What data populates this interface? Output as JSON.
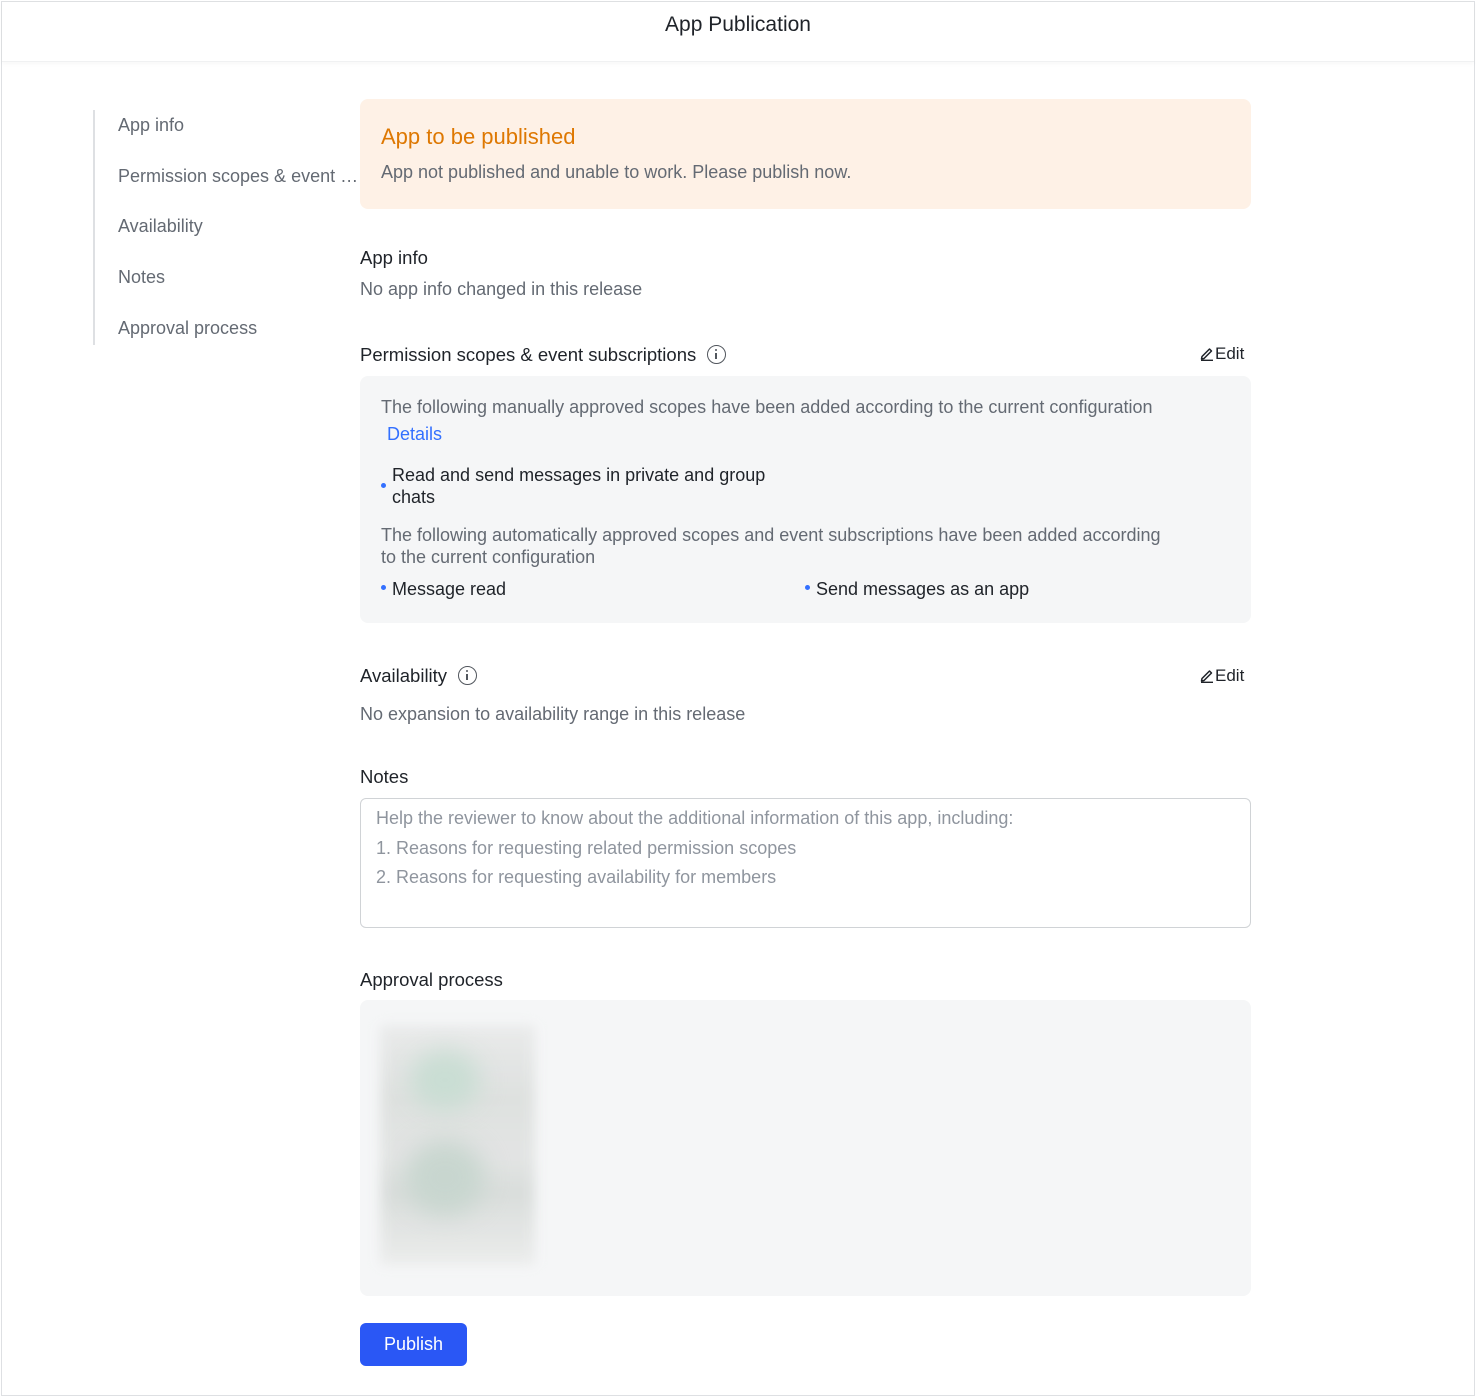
{
  "header": {
    "title": "App Publication"
  },
  "sidebar": {
    "items": [
      {
        "label": "App info"
      },
      {
        "label": "Permission scopes & event subscriptions"
      },
      {
        "label": "Availability"
      },
      {
        "label": "Notes"
      },
      {
        "label": "Approval process"
      }
    ]
  },
  "banner": {
    "title": "App to be published",
    "text": "App not published and unable to work. Please publish now."
  },
  "app_info": {
    "title": "App info",
    "text": "No app info changed in this release"
  },
  "permissions": {
    "title": "Permission scopes & event subscriptions",
    "edit_label": "Edit",
    "manual_text": "The following manually approved scopes have been added according to the current configuration",
    "details_link": "Details",
    "manual_scopes": [
      "Read and send messages in private and group",
      "chats"
    ],
    "auto_text_line1": "The following automatically approved scopes and event subscriptions have been added according",
    "auto_text_line2": "to the current configuration",
    "auto_scopes": [
      "Message read",
      "Send messages as an app"
    ]
  },
  "availability": {
    "title": "Availability",
    "edit_label": "Edit",
    "text": "No expansion to availability range in this release"
  },
  "notes": {
    "title": "Notes",
    "placeholder": "Help the reviewer to know about the additional information of this app, including:\n1. Reasons for requesting related permission scopes\n2. Reasons for requesting availability for members",
    "value": ""
  },
  "approval": {
    "title": "Approval process"
  },
  "actions": {
    "publish_label": "Publish"
  },
  "colors": {
    "primary": "#2a57f5",
    "link": "#3370ff",
    "warning_bg": "#fef1e6",
    "warning_text": "#de7802"
  }
}
